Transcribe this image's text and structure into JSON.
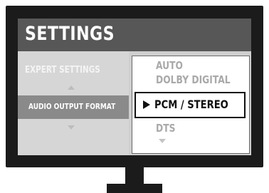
{
  "header": {
    "title": "SETTINGS"
  },
  "left_menu": {
    "items": [
      {
        "label": "EXPERT SETTINGS",
        "selected": false
      },
      {
        "label": "AUDIO OUTPUT FORMAT",
        "selected": true
      }
    ],
    "scroll_up_icon": "triangle-up",
    "scroll_down_icon": "triangle-down"
  },
  "options": {
    "items": [
      {
        "label": "AUTO",
        "selected": false
      },
      {
        "label": "DOLBY DIGITAL",
        "selected": false
      },
      {
        "label": "PCM / STEREO",
        "selected": true
      },
      {
        "label": "DTS",
        "selected": false
      }
    ],
    "selected_marker_icon": "play-triangle",
    "scroll_down_icon": "triangle-down"
  },
  "colors": {
    "bezel": "#1b1b1b",
    "title_bar": "#575757",
    "screen_bg": "#d6d6d6",
    "selected_row": "#8a8a8a",
    "dim_text": "#a9a9a9"
  }
}
